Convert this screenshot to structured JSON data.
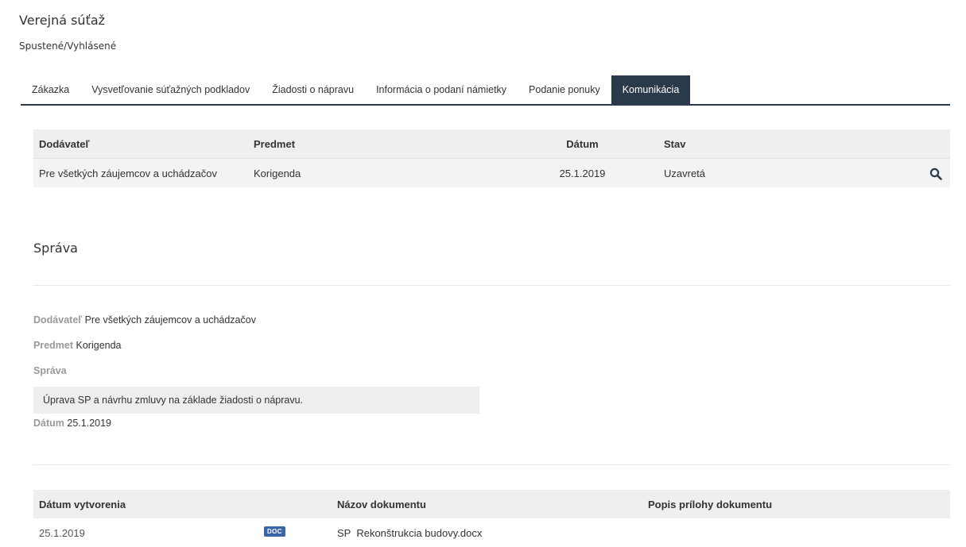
{
  "header": {
    "title": "Verejná súťaž",
    "subtitle": "Spustené/Vyhlásené"
  },
  "tabs": [
    {
      "label": "Zákazka",
      "active": false
    },
    {
      "label": "Vysvetľovanie súťažných podkladov",
      "active": false
    },
    {
      "label": "Žiadosti o nápravu",
      "active": false
    },
    {
      "label": "Informácia o podaní námietky",
      "active": false
    },
    {
      "label": "Podanie ponuky",
      "active": false
    },
    {
      "label": "Komunikácia",
      "active": true
    }
  ],
  "communication_table": {
    "columns": [
      "Dodávateľ",
      "Predmet",
      "Dátum",
      "Stav"
    ],
    "rows": [
      {
        "supplier": "Pre všetkých záujemcov a uchádzačov",
        "subject": "Korigenda",
        "date": "25.1.2019",
        "status": "Uzavretá",
        "action_icon": "search-icon"
      }
    ]
  },
  "message": {
    "section_title": "Správa",
    "supplier_label": "Dodávateľ",
    "supplier_value": "Pre všetkých záujemcov a uchádzačov",
    "subject_label": "Predmet",
    "subject_value": "Korigenda",
    "message_label": "Správa",
    "message_text": "Úprava SP a návrhu zmluvy na základe žiadosti o nápravu.",
    "date_label": "Dátum",
    "date_value": "25.1.2019"
  },
  "documents_table": {
    "columns": [
      "Dátum vytvorenia",
      "",
      "Názov dokumentu",
      "Popis prílohy dokumentu"
    ],
    "rows": [
      {
        "created": "25.1.2019",
        "badge": "DOC",
        "name": "SP  Rekonštrukcia budovy.docx",
        "description": ""
      }
    ]
  },
  "colors": {
    "tab_active_bg": "#2b3a4a",
    "doc_badge": "#3a66a8",
    "label_gray": "#999999"
  }
}
